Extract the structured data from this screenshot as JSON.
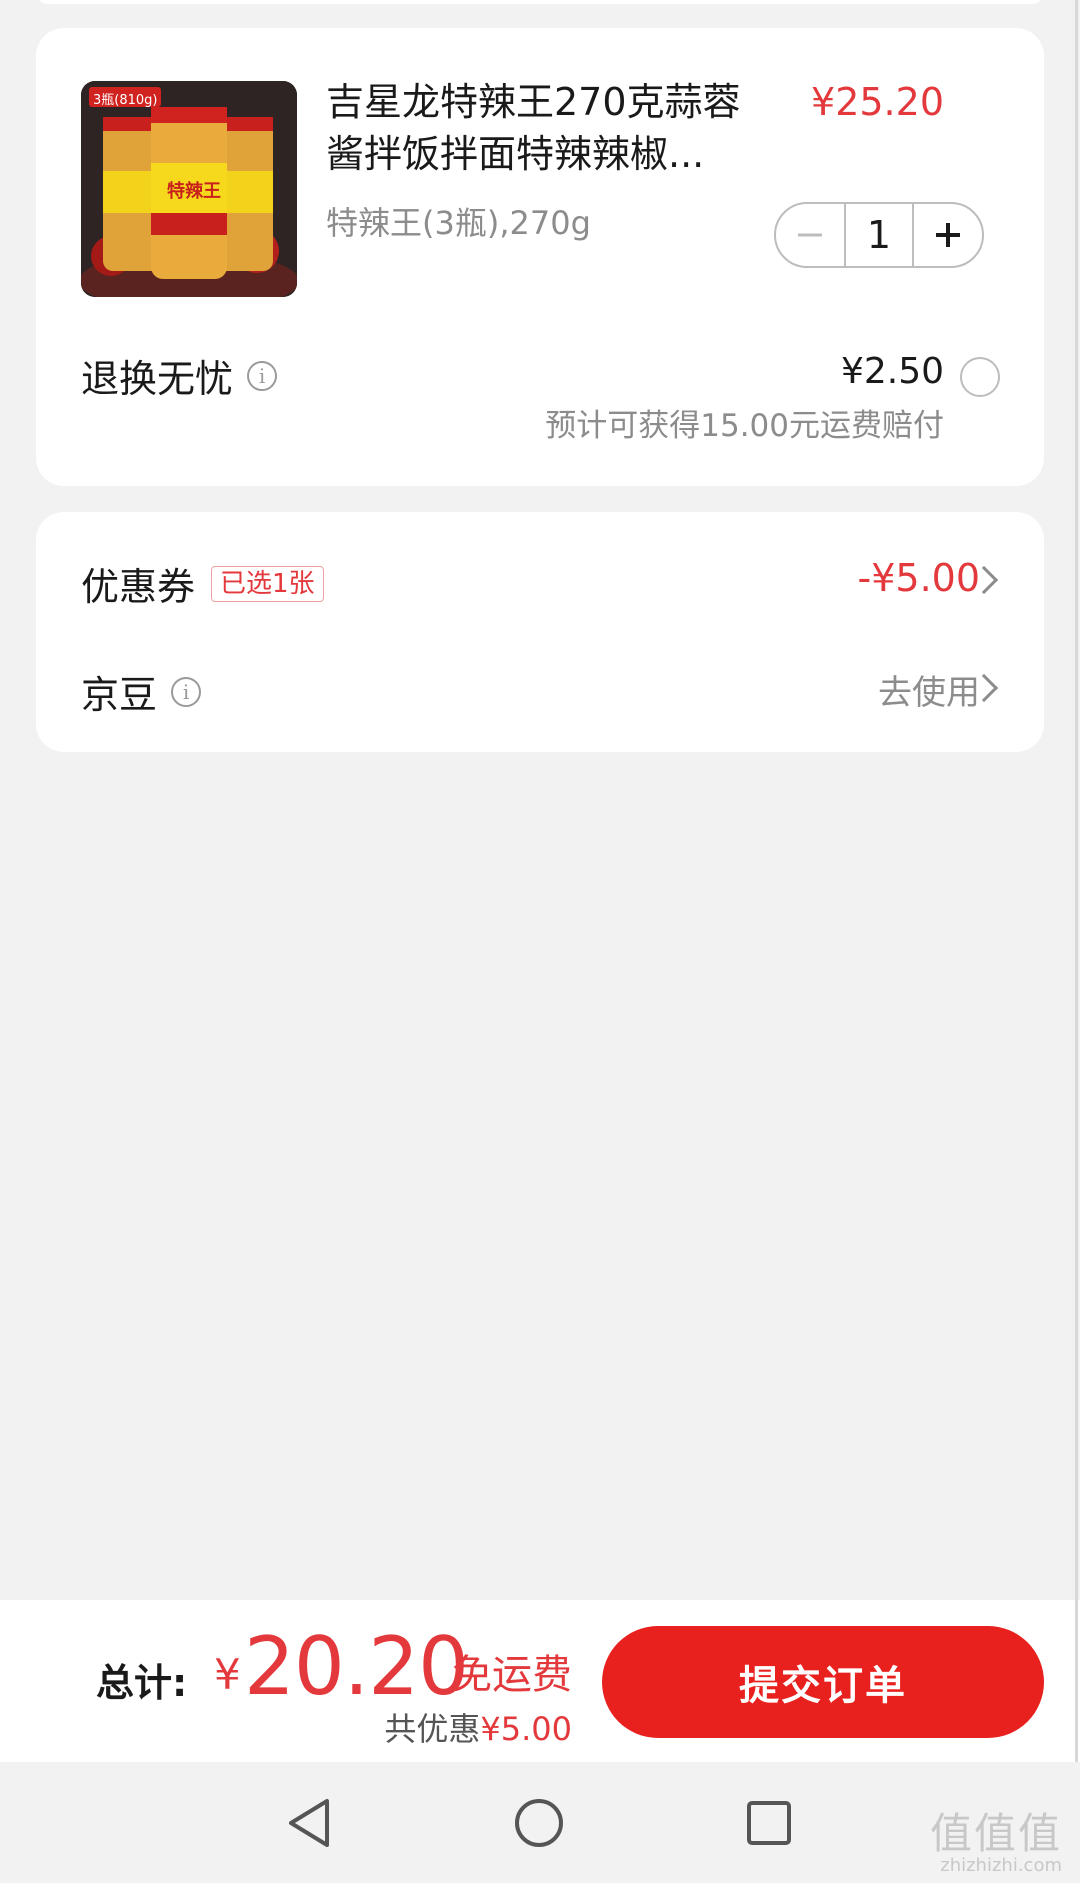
{
  "product": {
    "title": "吉星龙特辣王270克蒜蓉酱拌饭拌面特辣辣椒...",
    "price": "¥25.20",
    "spec": "特辣王(3瓶),270g",
    "quantity": "1",
    "image_tag": "3瓶(810g)",
    "jar_label": "特辣王"
  },
  "service": {
    "label": "退换无忧",
    "price": "¥2.50",
    "note": "预计可获得15.00元运费赔付"
  },
  "coupon": {
    "label": "优惠券",
    "tag": "已选1张",
    "discount": "-¥5.00"
  },
  "jingdou": {
    "label": "京豆",
    "action": "去使用"
  },
  "footer": {
    "total_label": "总计:",
    "currency": "¥",
    "total_amount": "20.20",
    "shipping": "免运费",
    "saved_prefix": "共优惠",
    "saved_amount": "¥5.00",
    "submit_label": "提交订单"
  },
  "watermark": {
    "text": "值值值",
    "sub": "zhizhizhi.com"
  },
  "colors": {
    "accent": "#e4393c",
    "button": "#e8201e",
    "background": "#f2f2f2"
  }
}
